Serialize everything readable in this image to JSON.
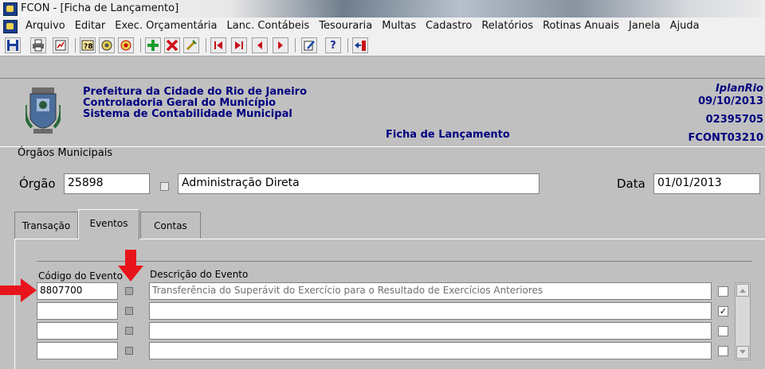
{
  "window": {
    "title": "FCON - [Ficha de Lançamento]"
  },
  "menu": [
    "Arquivo",
    "Editar",
    "Exec. Orçamentária",
    "Lanc. Contábeis",
    "Tesouraria",
    "Multas",
    "Cadastro",
    "Relatórios",
    "Rotinas Anuais",
    "Janela",
    "Ajuda"
  ],
  "toolbar": {
    "icons": [
      "save-icon",
      "print-icon",
      "report-icon",
      "query-icon",
      "enter-query-icon",
      "execute-query-icon",
      "insert-record-icon",
      "delete-record-icon",
      "clear-icon",
      "first-record-icon",
      "last-record-icon",
      "previous-record-icon",
      "next-record-icon",
      "edit-icon",
      "help-icon",
      "exit-icon"
    ],
    "help_glyph": "?"
  },
  "header": {
    "lines": [
      "Prefeitura da Cidade do Rio de Janeiro",
      "Controladoria Geral do Município",
      "Sistema de Contabilidade Municipal"
    ],
    "brand": "IplanRio",
    "date": "09/10/2013",
    "user": "02395705",
    "form_code": "FCONT03210",
    "form_title": "Ficha de Lançamento"
  },
  "orgaos": {
    "section_label": "Órgãos Municipais",
    "orgao_label": "Órgão",
    "orgao_value": "25898",
    "orgao_desc": "Administração Direta",
    "data_label": "Data",
    "data_value": "01/01/2013"
  },
  "tabs": [
    {
      "label": "Transação",
      "active": false
    },
    {
      "label": "Eventos",
      "active": true
    },
    {
      "label": "Contas",
      "active": false
    }
  ],
  "eventos": {
    "col_codigo": "Código do Evento",
    "col_descricao": "Descrição do Evento",
    "rows": [
      {
        "codigo": "8807700",
        "descricao": "Transferência do Superávit do Exercício para o Resultado de Exercícios Anteriores",
        "checked": false
      },
      {
        "codigo": "",
        "descricao": "",
        "checked": true
      },
      {
        "codigo": "",
        "descricao": "",
        "checked": false
      },
      {
        "codigo": "",
        "descricao": "",
        "checked": false
      }
    ],
    "check_mark": "✓"
  },
  "colors": {
    "header_text": "#000080",
    "annotation_arrow": "#e8141b",
    "form_bg": "#c0c0c0"
  }
}
